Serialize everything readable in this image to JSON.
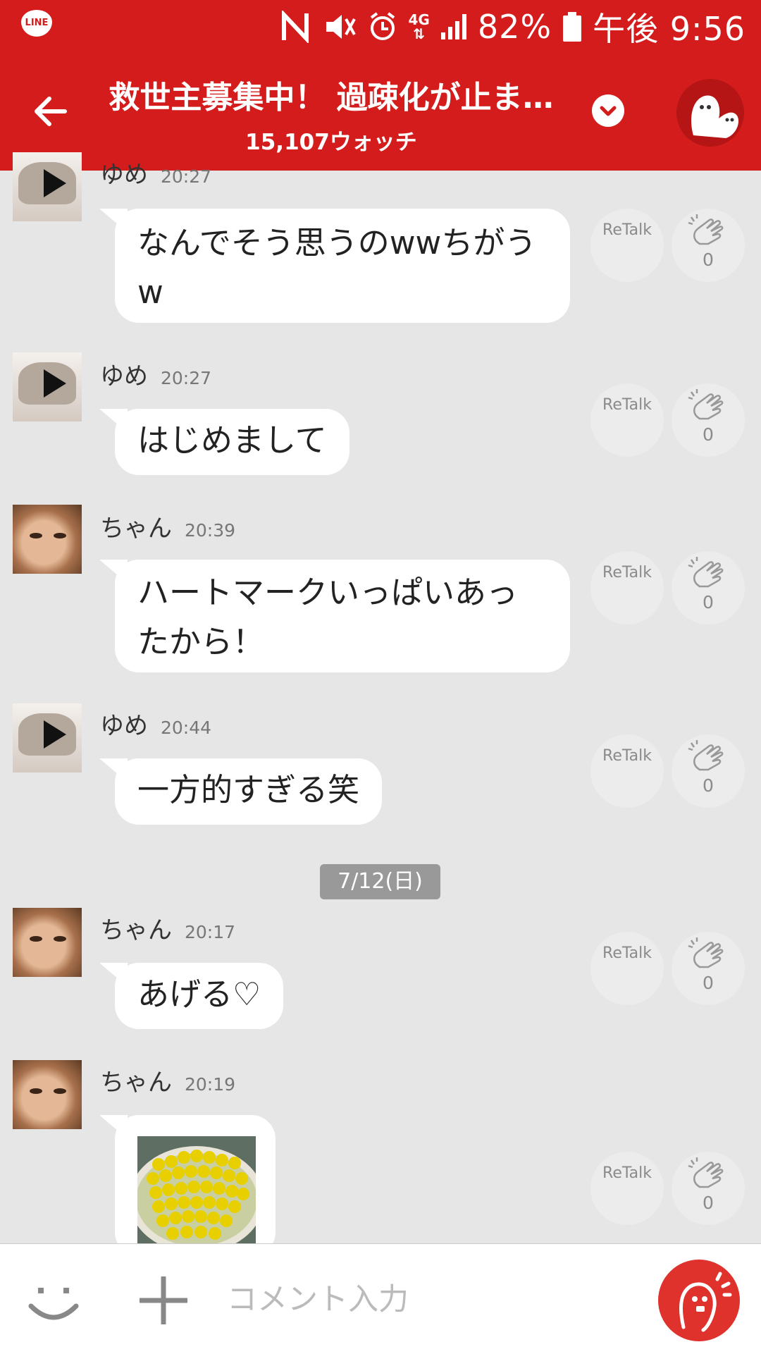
{
  "status_bar": {
    "app_badge": "LINE",
    "network": "4G",
    "battery": "82%",
    "time": "午後 9:56"
  },
  "header": {
    "title": "救世主募集中！ 過疎化が止ま…",
    "watch_count": "15,107ウォッチ"
  },
  "messages": [
    {
      "user": "ゆめ",
      "time": "20:27",
      "text": "なんでそう思うのwwちがうw",
      "retalk": "ReTalk",
      "claps": "0"
    },
    {
      "user": "ゆめ",
      "time": "20:27",
      "text": "はじめまして",
      "retalk": "ReTalk",
      "claps": "0"
    },
    {
      "user": "ちゃん",
      "time": "20:39",
      "text": "ハートマークいっぱいあったから！",
      "retalk": "ReTalk",
      "claps": "0"
    },
    {
      "user": "ゆめ",
      "time": "20:44",
      "text": "一方的すぎる笑",
      "retalk": "ReTalk",
      "claps": "0"
    },
    {
      "user": "ちゃん",
      "time": "20:17",
      "text": "あげる♡",
      "retalk": "ReTalk",
      "claps": "0"
    },
    {
      "user": "ちゃん",
      "time": "20:19",
      "text": "",
      "retalk": "ReTalk",
      "claps": "0"
    }
  ],
  "date_separator": "7/12(日)",
  "composer": {
    "placeholder": "コメント入力"
  },
  "icons": {
    "back": "arrow-left-icon",
    "dropdown": "chevron-down-icon",
    "emoji": "smile-icon",
    "plus": "plus-icon",
    "send": "character-shout-icon",
    "clap": "clapping-hands-icon"
  },
  "colors": {
    "brand": "#d41c1c",
    "background": "#e6e6e6",
    "bubble": "#ffffff",
    "send_button": "#e0322c"
  }
}
